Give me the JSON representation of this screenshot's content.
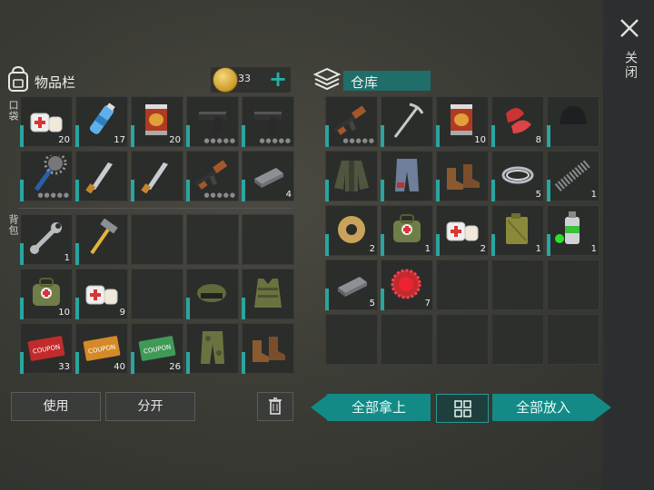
{
  "inventory": {
    "title": "物品栏",
    "pocket_label": "口袋",
    "backpack_label": "背包",
    "coins": "33",
    "plus": "+",
    "use_button": "使用",
    "split_button": "分开",
    "pocket_slots": [
      {
        "icon": "bandage-icon",
        "count": "20"
      },
      {
        "icon": "water-bottle-icon",
        "count": "17"
      },
      {
        "icon": "canned-food-icon",
        "count": "20"
      },
      {
        "icon": "pistol-icon",
        "count": "",
        "durability": true
      },
      {
        "icon": "pistol-icon",
        "count": "",
        "durability": true
      },
      {
        "icon": "spiked-club-icon",
        "count": "",
        "durability": true
      },
      {
        "icon": "machete-icon",
        "count": ""
      },
      {
        "icon": "machete-icon",
        "count": ""
      },
      {
        "icon": "assault-rifle-icon",
        "count": "",
        "durability": true
      },
      {
        "icon": "iron-bar-icon",
        "count": "4"
      }
    ],
    "backpack_slots": [
      {
        "icon": "wrench-icon",
        "count": "1"
      },
      {
        "icon": "hammer-icon",
        "count": ""
      },
      {
        "icon": "",
        "count": ""
      },
      {
        "icon": "",
        "count": ""
      },
      {
        "icon": "",
        "count": ""
      },
      {
        "icon": "first-aid-bag-icon",
        "count": "10"
      },
      {
        "icon": "bandage-icon",
        "count": "9"
      },
      {
        "icon": "",
        "count": ""
      },
      {
        "icon": "cap-with-glasses-icon",
        "count": ""
      },
      {
        "icon": "camo-vest-icon",
        "count": ""
      },
      {
        "icon": "red-coupon-icon",
        "count": "33",
        "label": "COUPON"
      },
      {
        "icon": "orange-coupon-icon",
        "count": "40",
        "label": "COUPON"
      },
      {
        "icon": "green-coupon-icon",
        "count": "26",
        "label": "COUPON"
      },
      {
        "icon": "camo-pants-icon",
        "count": ""
      },
      {
        "icon": "boots-icon",
        "count": ""
      }
    ]
  },
  "warehouse": {
    "title": "仓库",
    "take_all": "全部拿上",
    "put_all": "全部放入",
    "slots": [
      {
        "icon": "assault-rifle-icon",
        "count": "",
        "durability": true
      },
      {
        "icon": "pickaxe-icon",
        "count": ""
      },
      {
        "icon": "canned-food-icon",
        "count": "10"
      },
      {
        "icon": "raw-meat-icon",
        "count": "8"
      },
      {
        "icon": "beanie-icon",
        "count": ""
      },
      {
        "icon": "jacket-icon",
        "count": ""
      },
      {
        "icon": "jeans-icon",
        "count": ""
      },
      {
        "icon": "boots-icon",
        "count": ""
      },
      {
        "icon": "wire-icon",
        "count": "5"
      },
      {
        "icon": "spring-icon",
        "count": "1"
      },
      {
        "icon": "tape-roll-icon",
        "count": "2"
      },
      {
        "icon": "first-aid-bag-icon",
        "count": "1"
      },
      {
        "icon": "bandage-icon",
        "count": "2"
      },
      {
        "icon": "jerrycan-icon",
        "count": "1"
      },
      {
        "icon": "spray-can-icon",
        "count": "1"
      },
      {
        "icon": "iron-bar-icon",
        "count": "5"
      },
      {
        "icon": "bottle-cap-icon",
        "count": "7"
      }
    ]
  },
  "close_label": "关闭"
}
